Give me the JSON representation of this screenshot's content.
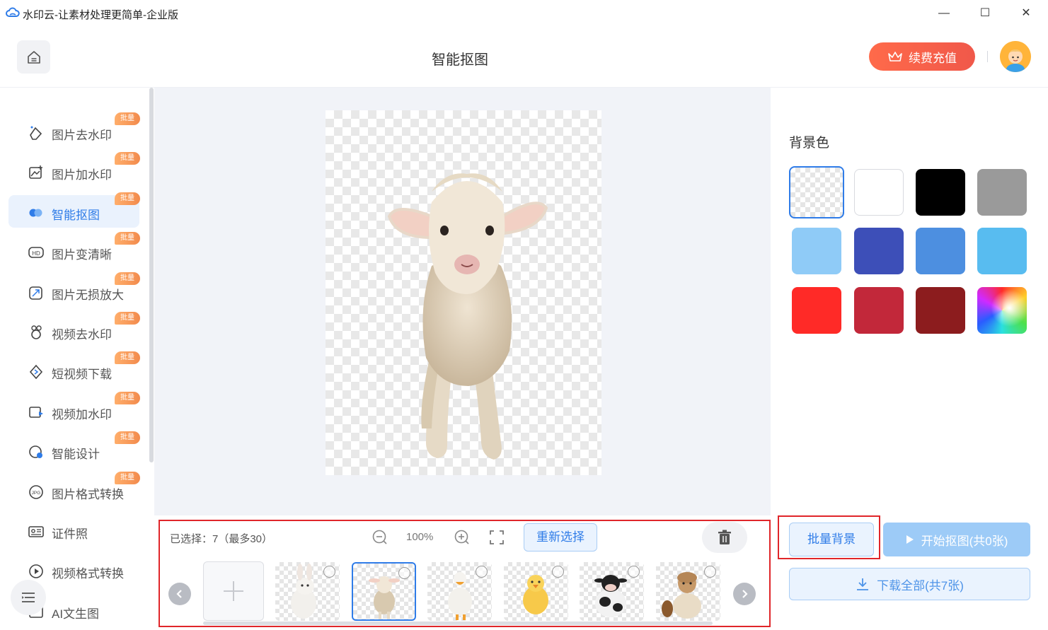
{
  "window": {
    "title": "水印云-让素材处理更简单-企业版",
    "minimize_glyph": "—",
    "maximize_glyph": "☐",
    "close_glyph": "✕"
  },
  "header": {
    "page_title": "智能抠图",
    "recharge_label": "续费充值",
    "brand_color": "#f0584a"
  },
  "sidebar": {
    "items": [
      {
        "label": "图片去水印",
        "badge": "批量",
        "icon": "eraser-icon"
      },
      {
        "label": "图片加水印",
        "badge": "批量",
        "icon": "image-add-icon"
      },
      {
        "label": "智能抠图",
        "badge": "批量",
        "icon": "cutout-icon"
      },
      {
        "label": "图片变清晰",
        "badge": "批量",
        "icon": "hd-icon"
      },
      {
        "label": "图片无损放大",
        "badge": "批量",
        "icon": "enlarge-icon"
      },
      {
        "label": "视频去水印",
        "badge": "批量",
        "icon": "video-eraser-icon"
      },
      {
        "label": "短视频下载",
        "badge": "批量",
        "icon": "download-video-icon"
      },
      {
        "label": "视频加水印",
        "badge": "批量",
        "icon": "video-add-icon"
      },
      {
        "label": "智能设计",
        "badge": "批量",
        "icon": "design-icon"
      },
      {
        "label": "图片格式转换",
        "badge": "批量",
        "icon": "jpg-icon"
      },
      {
        "label": "证件照",
        "badge": "",
        "icon": "id-photo-icon"
      },
      {
        "label": "视频格式转换",
        "badge": "",
        "icon": "play-circle-icon"
      },
      {
        "label": "AI文生图",
        "badge": "",
        "icon": "ai-image-icon"
      }
    ],
    "active_index": 2
  },
  "toolbar": {
    "selected_text": "已选择：7（最多30）",
    "zoom": "100%",
    "reselect_label": "重新选择"
  },
  "thumbnails": [
    {
      "name": "rabbit",
      "selected": false
    },
    {
      "name": "lamb",
      "selected": true
    },
    {
      "name": "duck",
      "selected": false
    },
    {
      "name": "chick",
      "selected": false
    },
    {
      "name": "cow",
      "selected": false
    },
    {
      "name": "alpaca",
      "selected": false
    }
  ],
  "right_panel": {
    "bg_title": "背景色",
    "swatches": [
      "transparent",
      "#ffffff",
      "#000000",
      "#9a9a9a",
      "#8fcbf7",
      "#3d4fb8",
      "#4d8fe0",
      "#58bcf0",
      "#ff2a27",
      "#c2283a",
      "#8c1c1e",
      "rainbow"
    ],
    "active_swatch": 0,
    "batch_bg_label": "批量背景",
    "start_label": "开始抠图(共0张)",
    "download_label": "下载全部(共7张)"
  }
}
